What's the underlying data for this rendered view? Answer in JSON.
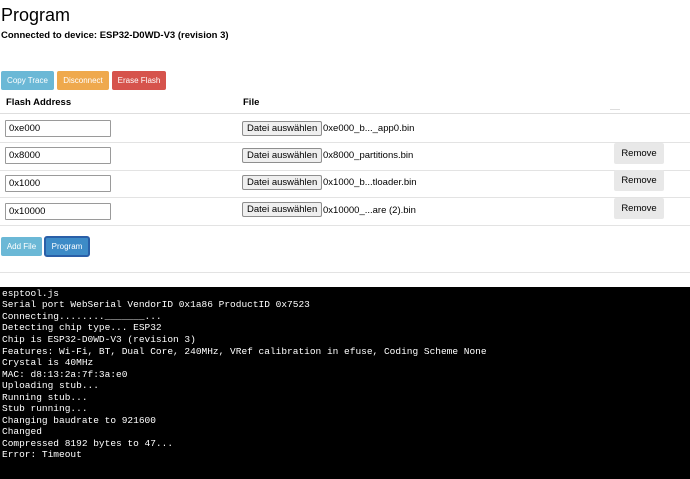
{
  "page": {
    "title": "Program",
    "connection": "Connected to device: ESP32-D0WD-V3 (revision 3)"
  },
  "toolbar": {
    "copy_trace": "Copy Trace",
    "disconnect": "Disconnect",
    "erase_flash": "Erase Flash"
  },
  "table": {
    "col_address": "Flash Address",
    "col_file": "File",
    "choose_label": "Datei auswählen",
    "remove_label": "Remove",
    "rows": [
      {
        "address": "0xe000",
        "file": "0xe000_b..._app0.bin",
        "removable": false
      },
      {
        "address": "0x8000",
        "file": "0x8000_partitions.bin",
        "removable": true
      },
      {
        "address": "0x1000",
        "file": "0x1000_b...tloader.bin",
        "removable": true
      },
      {
        "address": "0x10000",
        "file": "0x10000_...are (2).bin",
        "removable": true
      }
    ]
  },
  "actions": {
    "add_file": "Add File",
    "program": "Program"
  },
  "terminal": {
    "lines": [
      "esptool.js",
      "Serial port WebSerial VendorID 0x1a86 ProductID 0x7523",
      "Connecting........_______...",
      "Detecting chip type... ESP32",
      "Chip is ESP32-D0WD-V3 (revision 3)",
      "Features: Wi-Fi, BT, Dual Core, 240MHz, VRef calibration in efuse, Coding Scheme None",
      "Crystal is 40MHz",
      "MAC: d8:13:2a:7f:3a:e0",
      "Uploading stub...",
      "Running stub...",
      "Stub running...",
      "Changing baudrate to 921600",
      "Changed",
      "Compressed 8192 bytes to 47...",
      "Error: Timeout"
    ]
  },
  "colors": {
    "info": "#6bb8d6",
    "warning": "#efa94d",
    "danger": "#d6534c",
    "primary": "#3d8bc7",
    "terminal_bg": "#000000",
    "terminal_fg": "#ffffff"
  }
}
